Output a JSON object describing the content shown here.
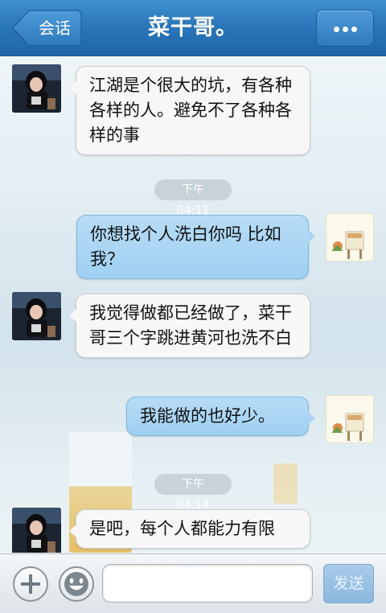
{
  "header": {
    "back_label": "会话",
    "title": "菜干哥。",
    "more_icon": "ellipsis-icon"
  },
  "messages": [
    {
      "side": "left",
      "text": "江湖是个很大的坑，有各种各样的人。避免不了各种各样的事"
    },
    {
      "side": "time",
      "text": "下午 04:11"
    },
    {
      "side": "right",
      "text": "你想找个人洗白你吗 比如我？"
    },
    {
      "side": "left",
      "text": "我觉得做都已经做了，菜干哥三个字跳进黄河也洗不白"
    },
    {
      "side": "right",
      "text": "我能做的也好少。"
    },
    {
      "side": "time",
      "text": "下午 04:14"
    },
    {
      "side": "left",
      "text": "是吧，每个人都能力有限"
    }
  ],
  "input": {
    "placeholder": "",
    "add_icon": "plus-icon",
    "emoji_icon": "smiley-icon",
    "send_label": "发送"
  },
  "colors": {
    "header": "#2a74b8",
    "my_bubble": "#a9d4f3",
    "their_bubble": "#f7f7f7"
  }
}
